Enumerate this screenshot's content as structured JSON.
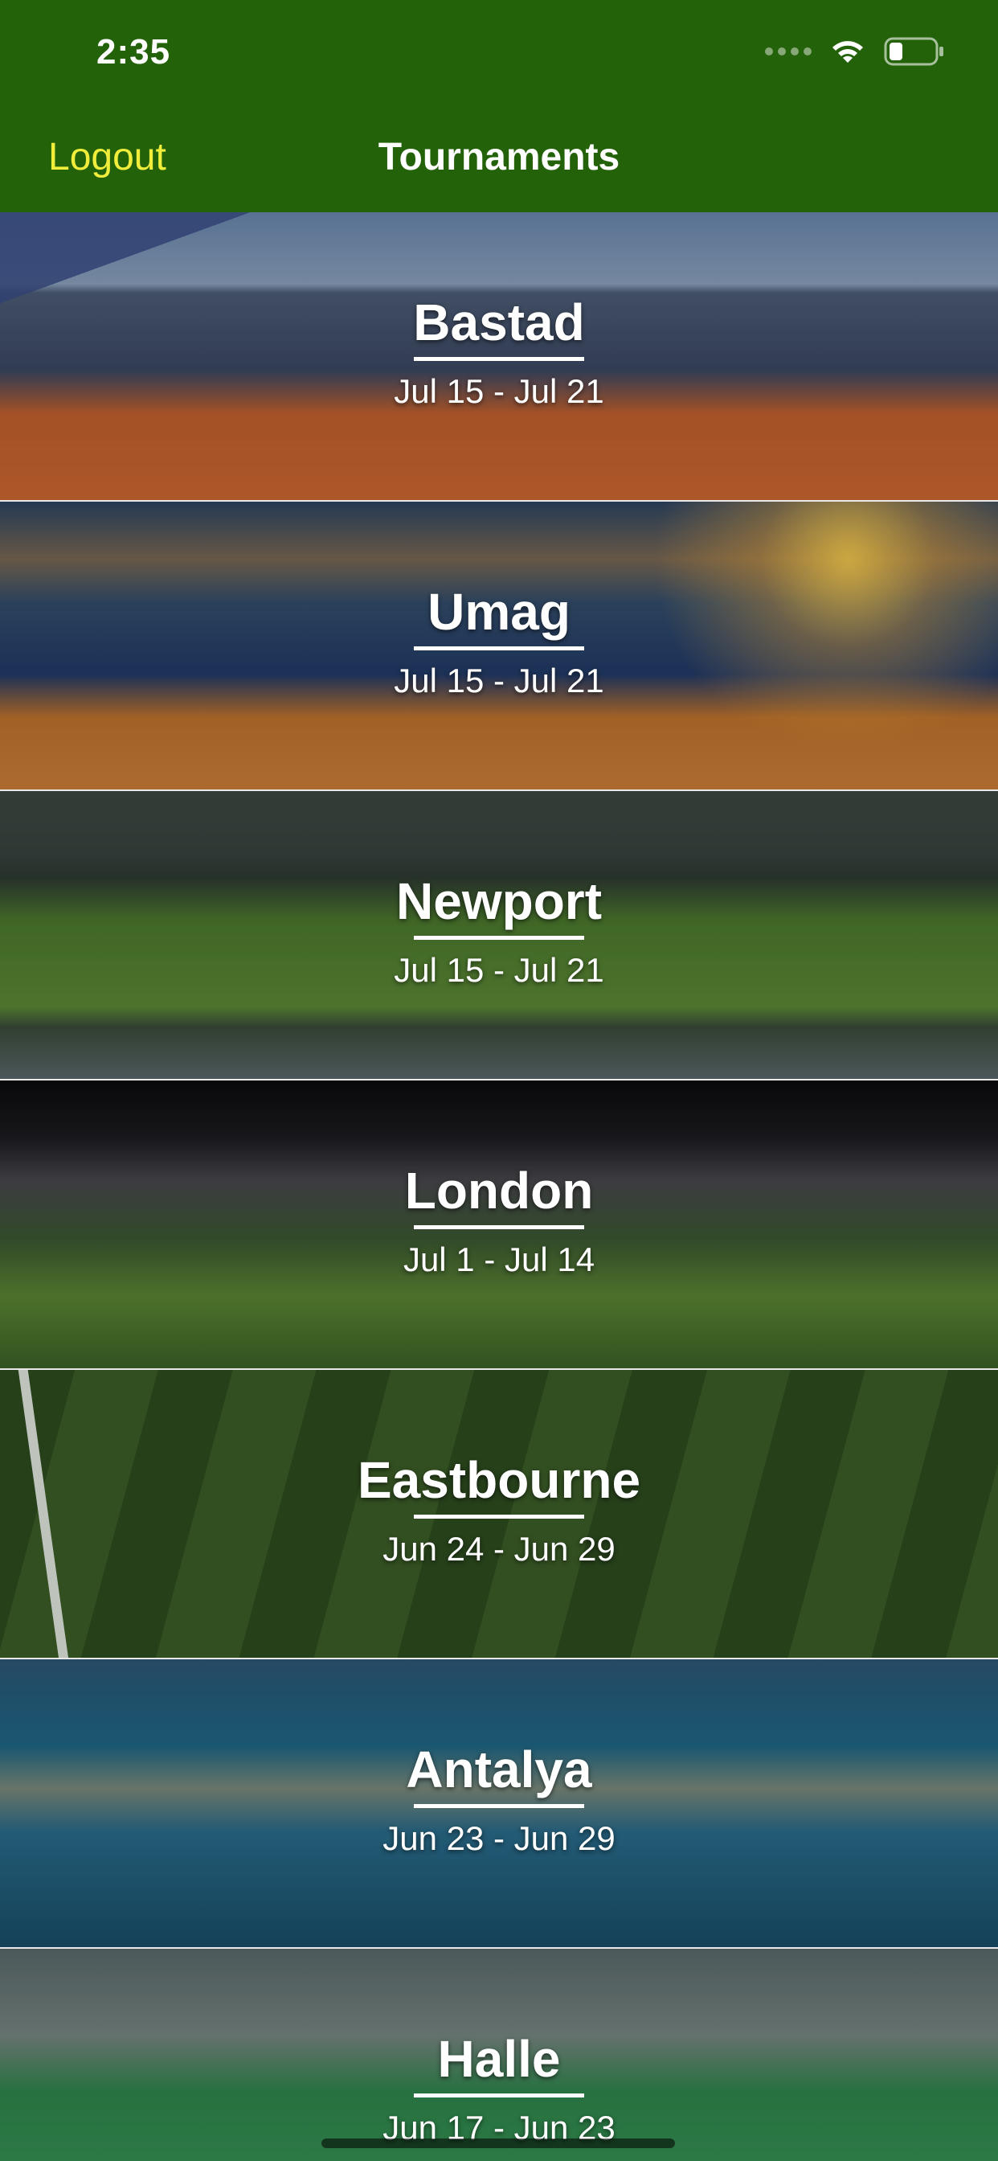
{
  "status_bar": {
    "time": "2:35"
  },
  "nav": {
    "left_button": "Logout",
    "title": "Tournaments"
  },
  "tournaments": [
    {
      "name": "Bastad",
      "dates": "Jul 15 - Jul 21"
    },
    {
      "name": "Umag",
      "dates": "Jul 15 - Jul 21"
    },
    {
      "name": "Newport",
      "dates": "Jul 15 - Jul 21"
    },
    {
      "name": "London",
      "dates": "Jul 1 - Jul 14"
    },
    {
      "name": "Eastbourne",
      "dates": "Jun 24 - Jun 29"
    },
    {
      "name": "Antalya",
      "dates": "Jun 23 - Jun 29"
    },
    {
      "name": "Halle",
      "dates": "Jun 17 - Jun 23"
    }
  ],
  "colors": {
    "nav_background": "#236209",
    "logout_color": "#f0ee3b"
  },
  "icons": {
    "wifi": "wifi-icon",
    "battery": "battery-icon",
    "signal": "signal-icon"
  }
}
